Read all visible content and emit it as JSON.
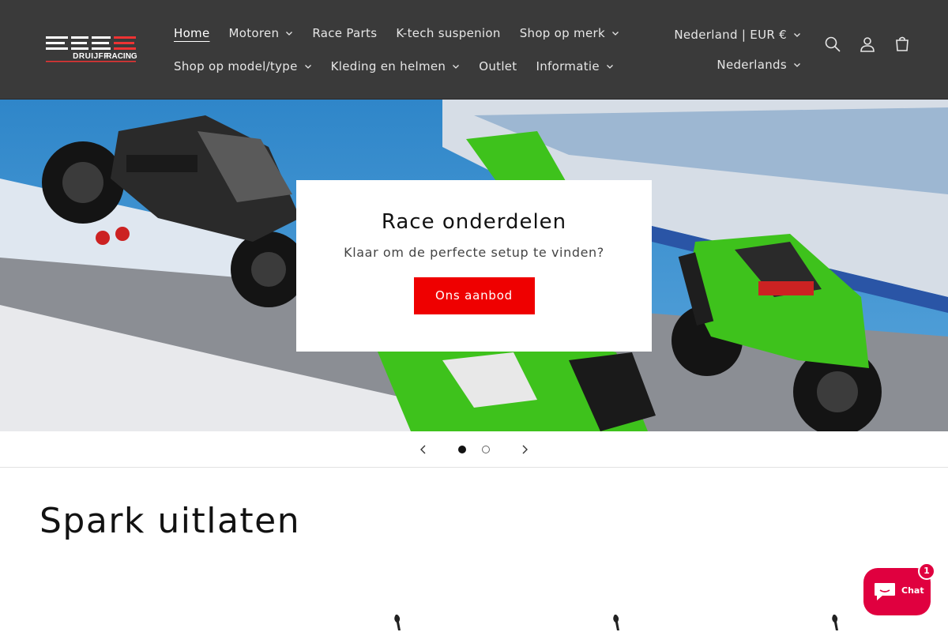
{
  "brand": {
    "logo_text": "DRUIJFF RACING",
    "accent": "#ef0000"
  },
  "nav": {
    "row1": [
      {
        "label": "Home",
        "active": true,
        "dropdown": false
      },
      {
        "label": "Motoren",
        "dropdown": true
      },
      {
        "label": "Race Parts",
        "dropdown": false
      },
      {
        "label": "K-tech suspenion",
        "dropdown": false
      },
      {
        "label": "Shop op merk",
        "dropdown": true
      }
    ],
    "row2": [
      {
        "label": "Shop op model/type",
        "dropdown": true
      },
      {
        "label": "Kleding en helmen",
        "dropdown": true
      },
      {
        "label": "Outlet",
        "dropdown": false
      },
      {
        "label": "Informatie",
        "dropdown": true
      }
    ]
  },
  "locale": {
    "country": "Nederland | EUR €",
    "language": "Nederlands"
  },
  "header_icons": [
    "search-icon",
    "account-icon",
    "cart-icon"
  ],
  "hero": {
    "title": "Race onderdelen",
    "subtitle": "Klaar om de perfecte setup te vinden?",
    "button": "Ons aanbod"
  },
  "slider": {
    "current": 1,
    "total": 2
  },
  "section": {
    "title": "Spark uitlaten"
  },
  "chat": {
    "label": "Chat",
    "badge": "1"
  }
}
